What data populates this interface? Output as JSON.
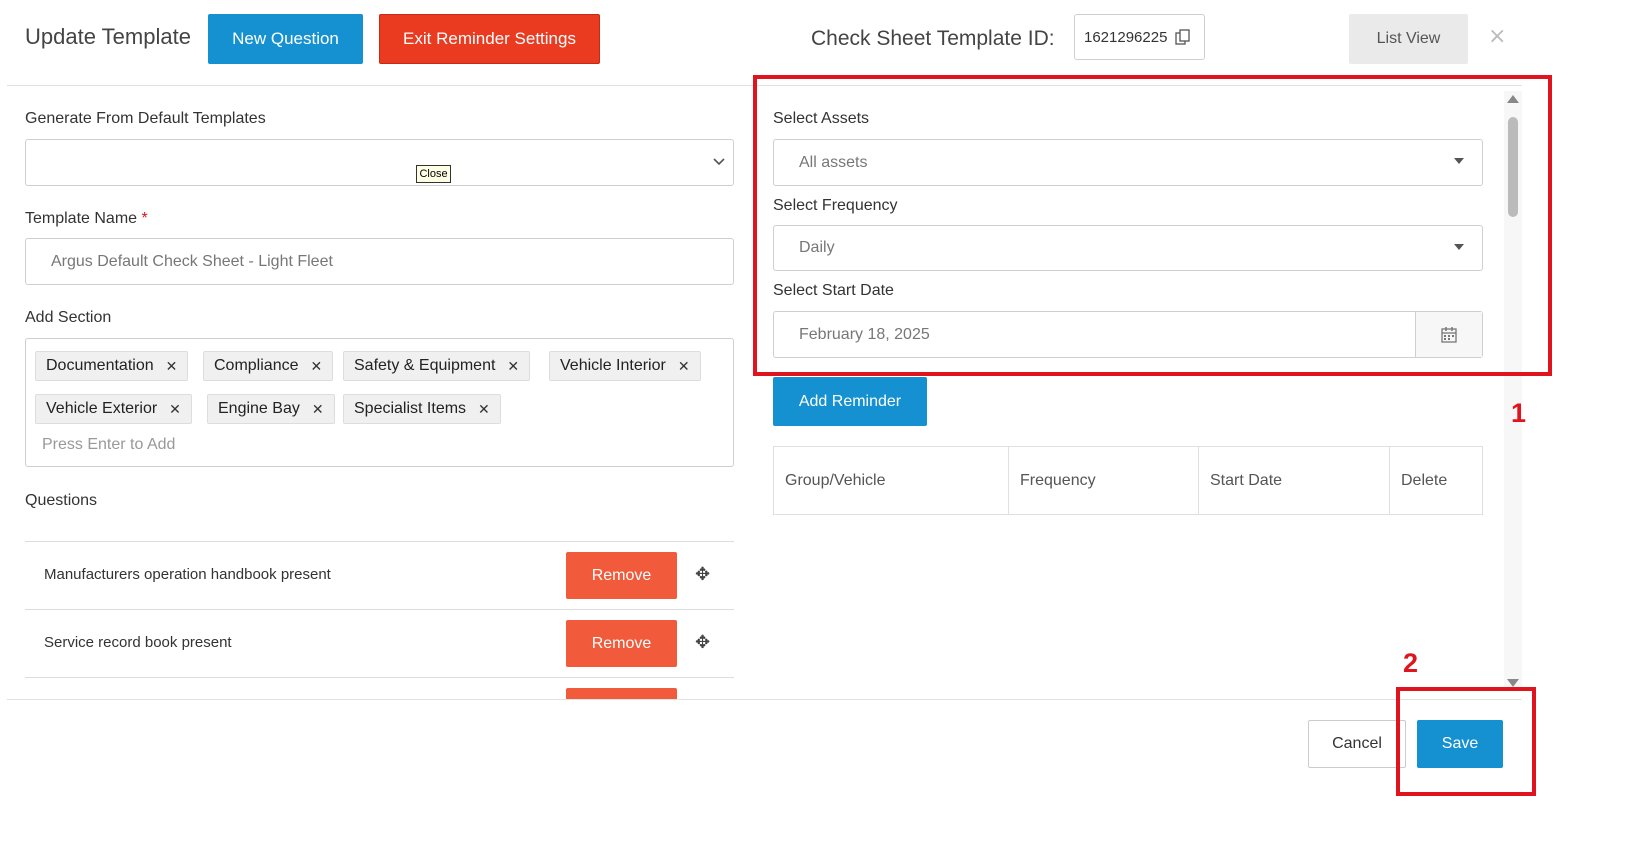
{
  "header": {
    "title": "Update Template",
    "new_question": "New Question",
    "exit_reminder": "Exit Reminder Settings",
    "template_id_label": "Check Sheet Template ID:",
    "template_id_value": "1621296225",
    "list_view": "List View",
    "close_symbol": "×"
  },
  "left": {
    "generate_label": "Generate From Default Templates",
    "generate_value": "",
    "close_tooltip": "Close",
    "template_name_label": "Template Name",
    "required_mark": "*",
    "template_name_value": "Argus Default Check Sheet - Light Fleet",
    "add_section_label": "Add Section",
    "sections": [
      "Documentation",
      "Compliance",
      "Safety & Equipment",
      "Vehicle Interior",
      "Vehicle Exterior",
      "Engine Bay",
      "Specialist Items"
    ],
    "add_placeholder": "Press Enter to Add",
    "questions_label": "Questions",
    "questions": [
      {
        "text": "Manufacturers operation handbook present",
        "remove": "Remove"
      },
      {
        "text": "Service record book present",
        "remove": "Remove"
      }
    ]
  },
  "right": {
    "assets_label": "Select Assets",
    "assets_value": "All assets",
    "frequency_label": "Select Frequency",
    "frequency_value": "Daily",
    "start_date_label": "Select Start Date",
    "start_date_value": "February 18, 2025",
    "add_reminder": "Add Reminder",
    "table_headers": [
      "Group/Vehicle",
      "Frequency",
      "Start Date",
      "Delete"
    ]
  },
  "footer": {
    "cancel": "Cancel",
    "save": "Save"
  },
  "annotations": {
    "one": "1",
    "two": "2"
  },
  "icons": {
    "remove_tag": "close-icon",
    "move": "move-icon",
    "calendar": "calendar-icon",
    "copy": "copy-icon",
    "dropdown": "chevron-down-icon"
  },
  "colors": {
    "primary_blue": "#1591d1",
    "exit_red": "#ea3a20",
    "remove_orange": "#f15a3a",
    "highlight_red": "#e0141e"
  }
}
